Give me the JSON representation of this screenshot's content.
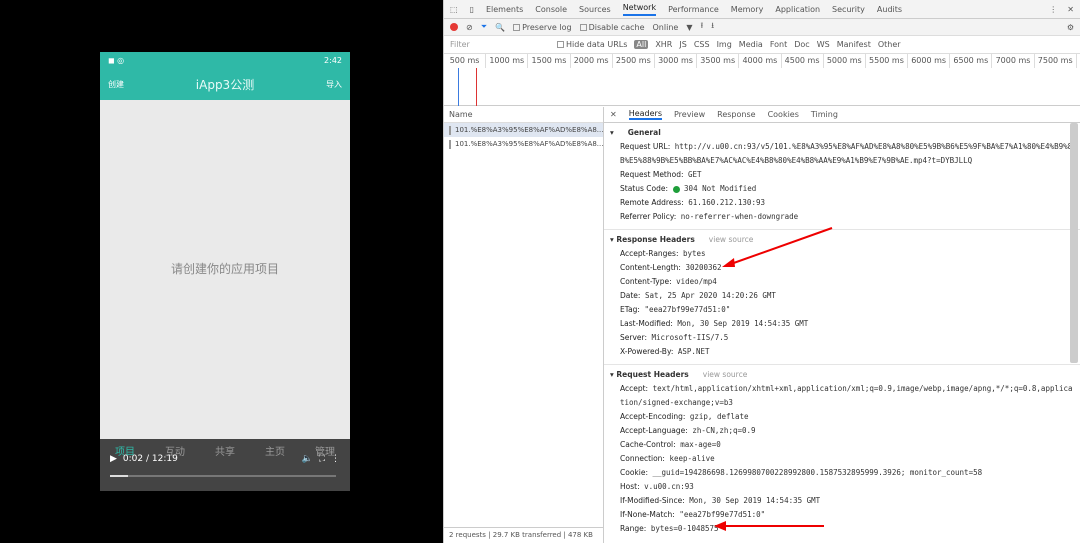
{
  "phone": {
    "status_time": "2:42",
    "create": "创建",
    "title": "iApp3公测",
    "import": "导入",
    "empty": "请创建你的应用项目",
    "tabs": [
      "项目",
      "互动",
      "共享",
      "主页",
      "管理"
    ],
    "player_time": "0:02 / 12:19"
  },
  "devtools": {
    "panels": [
      "Elements",
      "Console",
      "Sources",
      "Network",
      "Performance",
      "Memory",
      "Application",
      "Security",
      "Audits"
    ],
    "toolbar": {
      "preserve": "Preserve log",
      "disable": "Disable cache",
      "online": "Online"
    },
    "filter": {
      "placeholder": "Filter",
      "hide": "Hide data URLs",
      "types": [
        "XHR",
        "JS",
        "CSS",
        "Img",
        "Media",
        "Font",
        "Doc",
        "WS",
        "Manifest",
        "Other"
      ]
    },
    "timeline": [
      "500 ms",
      "1000 ms",
      "1500 ms",
      "2000 ms",
      "2500 ms",
      "3000 ms",
      "3500 ms",
      "4000 ms",
      "4500 ms",
      "5000 ms",
      "5500 ms",
      "6000 ms",
      "6500 ms",
      "7000 ms",
      "7500 ms"
    ],
    "name_header": "Name",
    "requests": [
      "101.%E8%A3%95%E8%AF%AD%E8%A8...",
      "101.%E8%A3%95%E8%AF%AD%E8%A8..."
    ],
    "footer": "2 requests | 29.7 KB transferred | 478 KB",
    "detail_tabs": [
      "Headers",
      "Preview",
      "Response",
      "Cookies",
      "Timing"
    ],
    "general": {
      "title": "General",
      "url_label": "Request URL:",
      "url": "http://v.u00.cn:93/v5/101.%E8%A3%95%E8%AF%AD%E8%A8%80%E5%9B%B6%E5%9F%BA%E7%A1%80%E4%B9%8B%E5%88%9B%E5%BB%BA%E7%AC%AC%E4%B8%80%E4%B8%AA%E9%A1%B9%E7%9B%AE.mp4?t=DYBJLLQ",
      "method_label": "Request Method:",
      "method": "GET",
      "status_label": "Status Code:",
      "status": "304 Not Modified",
      "remote_label": "Remote Address:",
      "remote": "61.160.212.130:93",
      "referrer_label": "Referrer Policy:",
      "referrer": "no-referrer-when-downgrade"
    },
    "response": {
      "title": "Response Headers",
      "view": "view source",
      "rows": [
        [
          "Accept-Ranges:",
          "bytes"
        ],
        [
          "Content-Length:",
          "30200362"
        ],
        [
          "Content-Type:",
          "video/mp4"
        ],
        [
          "Date:",
          "Sat, 25 Apr 2020 14:20:26 GMT"
        ],
        [
          "ETag:",
          "\"eea27bf99e77d51:0\""
        ],
        [
          "Last-Modified:",
          "Mon, 30 Sep 2019 14:54:35 GMT"
        ],
        [
          "Server:",
          "Microsoft-IIS/7.5"
        ],
        [
          "X-Powered-By:",
          "ASP.NET"
        ]
      ]
    },
    "request": {
      "title": "Request Headers",
      "view": "view source",
      "accept_label": "Accept:",
      "accept": "text/html,application/xhtml+xml,application/xml;q=0.9,image/webp,image/apng,*/*;q=0.8,application/signed-exchange;v=b3",
      "rows": [
        [
          "Accept-Encoding:",
          "gzip, deflate"
        ],
        [
          "Accept-Language:",
          "zh-CN,zh;q=0.9"
        ],
        [
          "Cache-Control:",
          "max-age=0"
        ],
        [
          "Connection:",
          "keep-alive"
        ],
        [
          "Cookie:",
          "__guid=194286698.1269980700228992800.1587532895999.3926; monitor_count=58"
        ],
        [
          "Host:",
          "v.u00.cn:93"
        ],
        [
          "If-Modified-Since:",
          "Mon, 30 Sep 2019 14:54:35 GMT"
        ],
        [
          "If-None-Match:",
          "\"eea27bf99e77d51:0\""
        ],
        [
          "Range:",
          "bytes=0-1048575"
        ]
      ]
    }
  }
}
